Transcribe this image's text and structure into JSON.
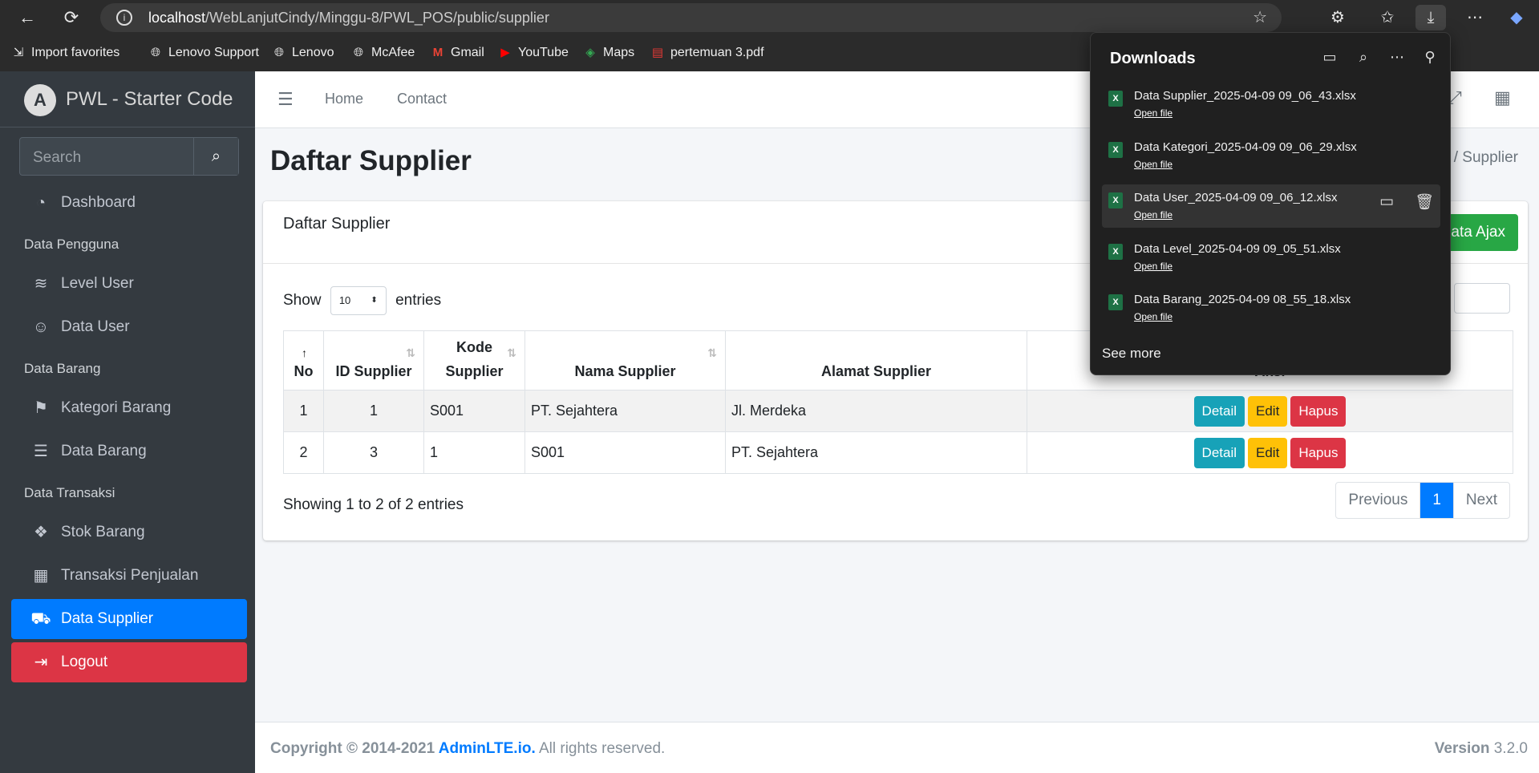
{
  "browser": {
    "url_host": "localhost",
    "url_path": "/WebLanjutCindy/Minggu-8/PWL_POS/public/supplier",
    "favorites": [
      {
        "label": "Import favorites",
        "icon": "import-icon"
      },
      {
        "label": "Lenovo Support",
        "icon": "globe-icon"
      },
      {
        "label": "Lenovo",
        "icon": "globe-icon"
      },
      {
        "label": "McAfee",
        "icon": "globe-icon"
      },
      {
        "label": "Gmail",
        "icon": "gmail-icon"
      },
      {
        "label": "YouTube",
        "icon": "youtube-icon"
      },
      {
        "label": "Maps",
        "icon": "maps-icon"
      },
      {
        "label": "pertemuan 3.pdf",
        "icon": "pdf-icon"
      }
    ]
  },
  "sidebar": {
    "brand": "PWL - Starter Code",
    "search_placeholder": "Search",
    "items": [
      {
        "label": "Dashboard",
        "icon": "tachometer-icon"
      },
      {
        "label": "Level User",
        "icon": "layers-icon"
      },
      {
        "label": "Data User",
        "icon": "user-icon"
      },
      {
        "label": "Kategori Barang",
        "icon": "bookmark-icon"
      },
      {
        "label": "Data Barang",
        "icon": "list-icon"
      },
      {
        "label": "Stok Barang",
        "icon": "cubes-icon"
      },
      {
        "label": "Transaksi Penjualan",
        "icon": "cash-register-icon"
      },
      {
        "label": "Data Supplier",
        "icon": "truck-icon"
      },
      {
        "label": "Logout",
        "icon": "sign-out-icon"
      }
    ],
    "headers": [
      "Data Pengguna",
      "Data Barang",
      "Data Transaksi"
    ]
  },
  "topnav": {
    "home": "Home",
    "contact": "Contact"
  },
  "page": {
    "title": "Daftar Supplier",
    "breadcrumb_current": "Supplier",
    "card_title": "Daftar Supplier",
    "add_button": "Tambah Data Ajax",
    "add_button_visible": "ata Ajax",
    "show_label": "Show",
    "entries_label": "entries",
    "length_value": "10"
  },
  "table": {
    "columns": [
      "No",
      "ID Supplier",
      "Kode Supplier",
      "Nama Supplier",
      "Alamat Supplier",
      "Aksi"
    ],
    "col_no": "No",
    "col_id": "ID Supplier",
    "col_kode_1": "Kode",
    "col_kode_2": "Supplier",
    "col_nama": "Nama Supplier",
    "col_alamat": "Alamat Supplier",
    "col_aksi": "Aksi",
    "rows": [
      {
        "no": "1",
        "id": "1",
        "kode": "S001",
        "nama": "PT. Sejahtera",
        "alamat": "Jl. Merdeka"
      },
      {
        "no": "2",
        "id": "3",
        "kode": "1",
        "nama": "S001",
        "alamat": "PT. Sejahtera"
      }
    ],
    "btn_detail": "Detail",
    "btn_edit": "Edit",
    "btn_hapus": "Hapus",
    "info": "Showing 1 to 2 of 2 entries",
    "pager": {
      "prev": "Previous",
      "page": "1",
      "next": "Next"
    }
  },
  "footer": {
    "copy_prefix": "Copyright © 2014-2021 ",
    "brand": "AdminLTE.io.",
    "copy_suffix": " All rights reserved.",
    "version_label": "Version",
    "version": "3.2.0"
  },
  "downloads": {
    "title": "Downloads",
    "open_file": "Open file",
    "see_more": "See more",
    "files": [
      "Data Supplier_2025-04-09 09_06_43.xlsx",
      "Data Kategori_2025-04-09 09_06_29.xlsx",
      "Data User_2025-04-09 09_06_12.xlsx",
      "Data Level_2025-04-09 09_05_51.xlsx",
      "Data Barang_2025-04-09 08_55_18.xlsx"
    ]
  },
  "colors": {
    "primary": "#007bff",
    "success": "#28a745",
    "danger": "#dc3545",
    "info": "#17a2b8",
    "warning": "#ffc107",
    "sidebar": "#343a40"
  }
}
